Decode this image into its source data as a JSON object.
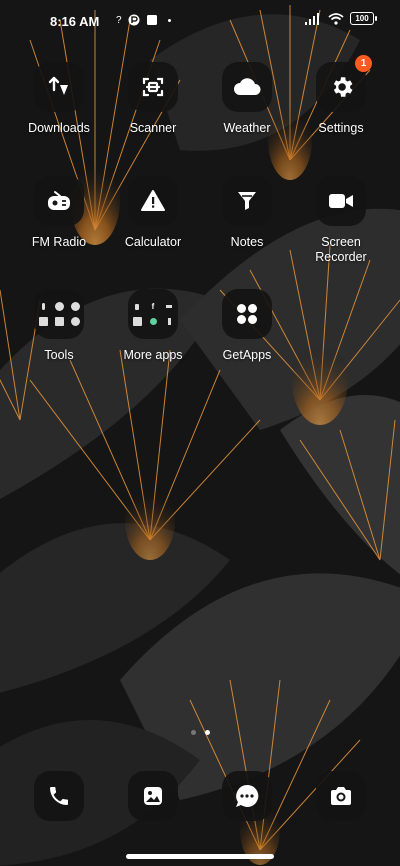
{
  "status_bar": {
    "time": "8:16 AM",
    "battery": "100"
  },
  "apps": [
    {
      "label": "Downloads",
      "icon": "downloads-icon"
    },
    {
      "label": "Scanner",
      "icon": "scanner-icon"
    },
    {
      "label": "Weather",
      "icon": "weather-icon"
    },
    {
      "label": "Settings",
      "icon": "settings-icon",
      "badge": "1"
    },
    {
      "label": "FM Radio",
      "icon": "radio-icon"
    },
    {
      "label": "Calculator",
      "icon": "calculator-icon"
    },
    {
      "label": "Notes",
      "icon": "notes-icon"
    },
    {
      "label": "Screen Recorder",
      "icon": "screen-recorder-icon"
    },
    {
      "label": "Tools",
      "icon": "tools-folder-icon"
    },
    {
      "label": "More apps",
      "icon": "more-apps-folder-icon"
    },
    {
      "label": "GetApps",
      "icon": "getapps-icon"
    }
  ],
  "dock": [
    {
      "name": "phone",
      "icon": "phone-icon"
    },
    {
      "name": "gallery",
      "icon": "gallery-icon"
    },
    {
      "name": "messages",
      "icon": "messages-icon"
    },
    {
      "name": "camera",
      "icon": "camera-icon"
    }
  ],
  "pages": {
    "count": 2,
    "active": 2
  },
  "colors": {
    "accent": "#f0a040",
    "badge": "#ff5a1f",
    "tile": "#161616"
  }
}
